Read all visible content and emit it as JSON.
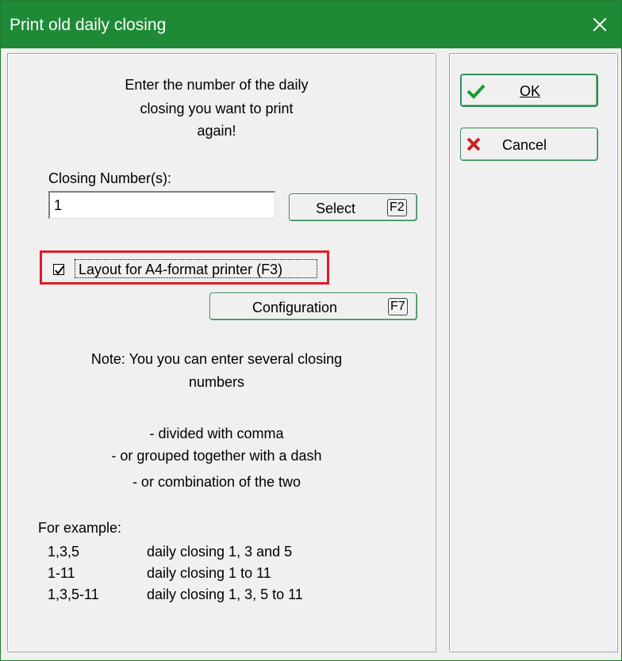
{
  "window": {
    "title": "Print old daily closing"
  },
  "intro": {
    "line1": "Enter the number of the daily",
    "line2": "closing you want to print",
    "line3": "again!"
  },
  "closing": {
    "label": "Closing Number(s):",
    "value": "1"
  },
  "select_button": {
    "label": "Select",
    "key": "F2"
  },
  "layout_checkbox": {
    "label": "Layout for A4-format printer (F3)",
    "checked": true
  },
  "config_button": {
    "label": "Configuration",
    "key": "F7"
  },
  "note": {
    "line1": "Note: You you can enter several closing",
    "line2": "numbers",
    "item1": "- divided with comma",
    "item2": "- or grouped together with a dash",
    "item3": "- or combination of the two"
  },
  "examples": {
    "heading": "For example:",
    "rows": [
      {
        "code": "1,3,5",
        "desc": "daily closing 1, 3 and 5"
      },
      {
        "code": "1-11",
        "desc": "daily closing 1 to 11"
      },
      {
        "code": "1,3,5-11",
        "desc": "daily closing 1, 3, 5 to 11"
      }
    ]
  },
  "ok_button": {
    "label": "OK"
  },
  "cancel_button": {
    "label": "Cancel"
  },
  "colors": {
    "titlebar": "#1f8a36",
    "highlight": "#e31b23",
    "ok_check": "#1a9a2a",
    "cancel_x": "#d02020"
  }
}
